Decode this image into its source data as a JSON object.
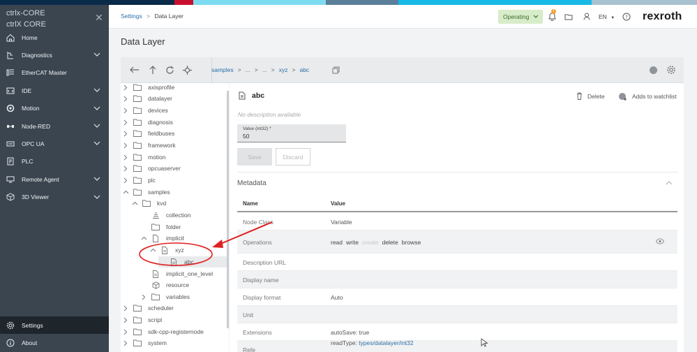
{
  "app": {
    "brand_line1": "ctrlx-CORE",
    "brand_line2": "ctrlX CORE",
    "logo": "rexroth"
  },
  "colors": {
    "strip": [
      "#0a2a4a",
      "#c8102e",
      "#7ddcf0",
      "#5b7f9a",
      "#17b9e6",
      "#a9c2d2"
    ],
    "sidebar_bg": "#3a4550",
    "accent_link": "#2b6fa8",
    "operating_bg": "#d7ecc9",
    "annotation": "#e02020"
  },
  "sidebar": {
    "items": [
      {
        "label": "Home",
        "icon": "home-icon",
        "expandable": false
      },
      {
        "label": "Diagnostics",
        "icon": "diagnostics-icon",
        "expandable": true
      },
      {
        "label": "EtherCAT Master",
        "icon": "ethercat-icon",
        "expandable": false
      },
      {
        "label": "IDE",
        "icon": "ide-icon",
        "expandable": true
      },
      {
        "label": "Motion",
        "icon": "motion-icon",
        "expandable": true
      },
      {
        "label": "Node-RED",
        "icon": "node-red-icon",
        "expandable": true
      },
      {
        "label": "OPC UA",
        "icon": "opc-ua-icon",
        "expandable": true
      },
      {
        "label": "PLC",
        "icon": "plc-icon",
        "expandable": false
      },
      {
        "label": "Remote Agent",
        "icon": "remote-agent-icon",
        "expandable": true
      },
      {
        "label": "3D Viewer",
        "icon": "3d-viewer-icon",
        "expandable": true
      }
    ],
    "bottom": [
      {
        "label": "Settings",
        "icon": "gear-icon",
        "active": true
      },
      {
        "label": "About",
        "icon": "info-icon",
        "active": false
      }
    ]
  },
  "header": {
    "breadcrumb_link": "Settings",
    "breadcrumb_sep": ">",
    "breadcrumb_current": "Data Layer",
    "operating_label": "Operating",
    "badge": "1",
    "lang": "EN"
  },
  "page": {
    "title": "Data Layer"
  },
  "toolbar": {
    "path": [
      "samples",
      "...",
      "...",
      "xyz",
      "abc"
    ],
    "sep": ">"
  },
  "tree": {
    "items": [
      {
        "label": "axisprofile",
        "depth": 0,
        "type": "folder",
        "expanded": false
      },
      {
        "label": "datalayer",
        "depth": 0,
        "type": "folder",
        "expanded": false
      },
      {
        "label": "devices",
        "depth": 0,
        "type": "folder",
        "expanded": false
      },
      {
        "label": "diagnosis",
        "depth": 0,
        "type": "folder",
        "expanded": false
      },
      {
        "label": "fieldbuses",
        "depth": 0,
        "type": "folder",
        "expanded": false
      },
      {
        "label": "framework",
        "depth": 0,
        "type": "folder",
        "expanded": false
      },
      {
        "label": "motion",
        "depth": 0,
        "type": "folder",
        "expanded": false
      },
      {
        "label": "opcuaserver",
        "depth": 0,
        "type": "folder",
        "expanded": false
      },
      {
        "label": "plc",
        "depth": 0,
        "type": "folder",
        "expanded": false
      },
      {
        "label": "samples",
        "depth": 0,
        "type": "folder",
        "expanded": true
      },
      {
        "label": "kvd",
        "depth": 1,
        "type": "folder",
        "expanded": true
      },
      {
        "label": "collection",
        "depth": 2,
        "type": "collection",
        "expanded": null
      },
      {
        "label": "folder",
        "depth": 2,
        "type": "folder",
        "expanded": null
      },
      {
        "label": "implicit",
        "depth": 2,
        "type": "file",
        "expanded": true
      },
      {
        "label": "xyz",
        "depth": 3,
        "type": "node",
        "expanded": true
      },
      {
        "label": "abc",
        "depth": 4,
        "type": "node",
        "expanded": null,
        "selected": true
      },
      {
        "label": "implicit_one_level",
        "depth": 2,
        "type": "node",
        "expanded": null
      },
      {
        "label": "resource",
        "depth": 2,
        "type": "resource",
        "expanded": null
      },
      {
        "label": "variables",
        "depth": 2,
        "type": "folder",
        "expanded": false
      },
      {
        "label": "scheduler",
        "depth": 0,
        "type": "folder",
        "expanded": false
      },
      {
        "label": "script",
        "depth": 0,
        "type": "folder",
        "expanded": false
      },
      {
        "label": "sdk-cpp-registernode",
        "depth": 0,
        "type": "folder",
        "expanded": false
      },
      {
        "label": "system",
        "depth": 0,
        "type": "folder",
        "expanded": false
      }
    ]
  },
  "detail": {
    "title": "abc",
    "no_description": "No description available",
    "delete_label": "Delete",
    "watchlist_label": "Adds to watchlist",
    "value_label": "Value (int32) *",
    "value": "50",
    "save_label": "Save",
    "discard_label": "Discard",
    "metadata_title": "Metadata",
    "columns": [
      "Name",
      "Value"
    ],
    "rows": [
      {
        "name": "Node Class",
        "value": "Variable"
      },
      {
        "name": "Operations",
        "ops": [
          {
            "label": "read",
            "enabled": true
          },
          {
            "label": "write",
            "enabled": true
          },
          {
            "label": "create",
            "enabled": false
          },
          {
            "label": "delete",
            "enabled": true
          },
          {
            "label": "browse",
            "enabled": true
          }
        ]
      },
      {
        "name": "Description URL",
        "value": ""
      },
      {
        "name": "Display name",
        "value": ""
      },
      {
        "name": "Display format",
        "value": "Auto"
      },
      {
        "name": "Unit",
        "value": ""
      },
      {
        "name": "Extensions",
        "value": "autoSave: true"
      },
      {
        "name": "Refe",
        "value_prefix": "readType: ",
        "value_link": "types/datalayer/int32"
      }
    ]
  }
}
